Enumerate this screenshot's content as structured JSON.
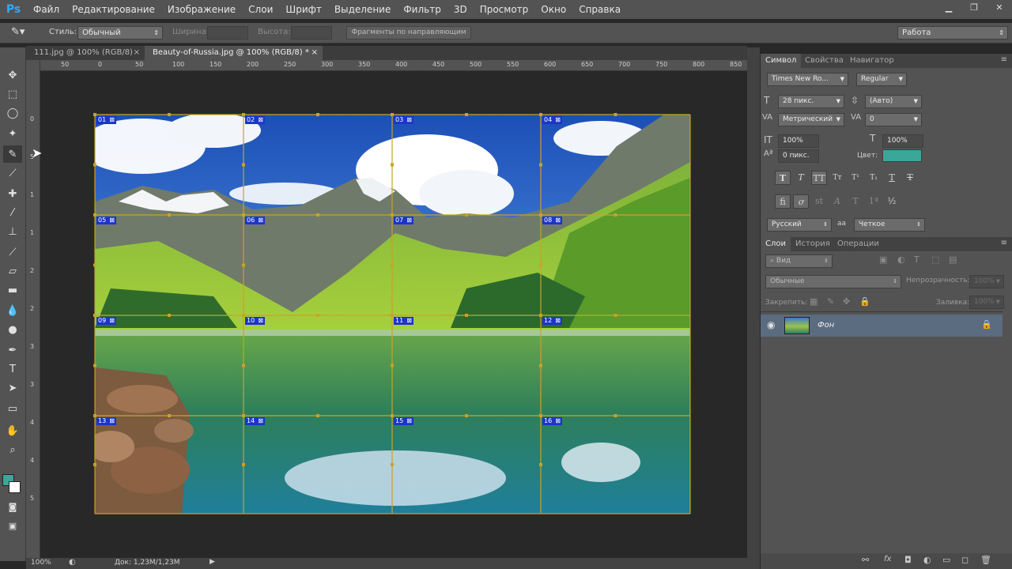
{
  "menu": {
    "logo": "Ps",
    "items": [
      "Файл",
      "Редактирование",
      "Изображение",
      "Слои",
      "Шрифт",
      "Выделение",
      "Фильтр",
      "3D",
      "Просмотр",
      "Окно",
      "Справка"
    ]
  },
  "options": {
    "style_label": "Стиль:",
    "style_value": "Обычный",
    "width_label": "Ширина:",
    "height_label": "Высота:",
    "slices_button": "Фрагменты по направляющим",
    "workspace": "Работа"
  },
  "tabs": [
    {
      "label": "111.jpg @ 100% (RGB/8)",
      "close": "×"
    },
    {
      "label": "Beauty-of-Russia.jpg @ 100% (RGB/8) *",
      "close": "×"
    }
  ],
  "ruler": {
    "h_ticks": [
      "50",
      "0",
      "50",
      "100",
      "150",
      "200",
      "250",
      "300",
      "350",
      "400",
      "450",
      "500",
      "550",
      "600",
      "650",
      "700",
      "750",
      "800",
      "850"
    ],
    "v_ticks": [
      "0",
      "5",
      "1",
      "1",
      "2",
      "2",
      "3",
      "3",
      "4",
      "4",
      "5"
    ]
  },
  "slices": [
    "01",
    "02",
    "03",
    "04",
    "05",
    "06",
    "07",
    "08",
    "09",
    "10",
    "11",
    "12",
    "13",
    "14",
    "15",
    "16"
  ],
  "status": {
    "zoom": "100%",
    "doc": "Док: 1,23M/1,23M"
  },
  "character_panel": {
    "tabs": [
      "Символ",
      "Свойства",
      "Навигатор"
    ],
    "font_family": "Times New Ro...",
    "font_style": "Regular",
    "size": "28 пикс.",
    "leading": "(Авто)",
    "kerning": "Метрический",
    "tracking": "0",
    "vscale": "100%",
    "hscale": "100%",
    "baseline": "0 пикс.",
    "color_label": "Цвет:",
    "color": "#3aa79a",
    "language": "Русский",
    "aa_label": "aa",
    "antialias": "Четкое"
  },
  "layers_panel": {
    "tabs": [
      "Слои",
      "История",
      "Операции"
    ],
    "filter": "Вид",
    "blend": "Обычные",
    "opacity_label": "Непрозрачность:",
    "opacity_value": "100%",
    "lock_label": "Закрепить:",
    "fill_label": "Заливка:",
    "fill_value": "100%",
    "layer_name": "Фон"
  },
  "colors": {
    "foreground": "#3aa79a",
    "background": "#ffffff",
    "slice_badge": "#1c35c9",
    "guide": "#c9a227"
  }
}
